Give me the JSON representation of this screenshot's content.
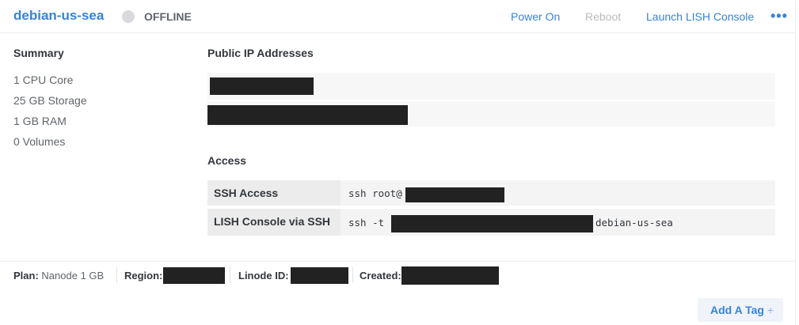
{
  "header": {
    "linode_name": "debian-us-sea",
    "status": "OFFLINE",
    "actions": {
      "power_on": "Power On",
      "reboot": "Reboot",
      "launch_lish": "Launch LISH Console"
    },
    "more_icon": "more-horizontal-icon"
  },
  "summary": {
    "title": "Summary",
    "items": [
      "1 CPU Core",
      "25 GB Storage",
      "1 GB RAM",
      "0 Volumes"
    ]
  },
  "ips": {
    "title": "Public IP Addresses"
  },
  "access": {
    "title": "Access",
    "rows": [
      {
        "label": "SSH Access",
        "prefix": "ssh root@",
        "suffix": ""
      },
      {
        "label": "LISH Console via SSH",
        "prefix": "ssh -t",
        "suffix": "debian-us-sea"
      }
    ]
  },
  "footer": {
    "plan_label": "Plan:",
    "plan_value": "Nanode 1 GB",
    "region_label": "Region:",
    "id_label": "Linode ID:",
    "created_label": "Created:"
  },
  "tags": {
    "add_label": "Add A Tag",
    "add_icon": "+"
  },
  "colors": {
    "accent": "#3683dc",
    "offline": "#d8d9dc"
  }
}
